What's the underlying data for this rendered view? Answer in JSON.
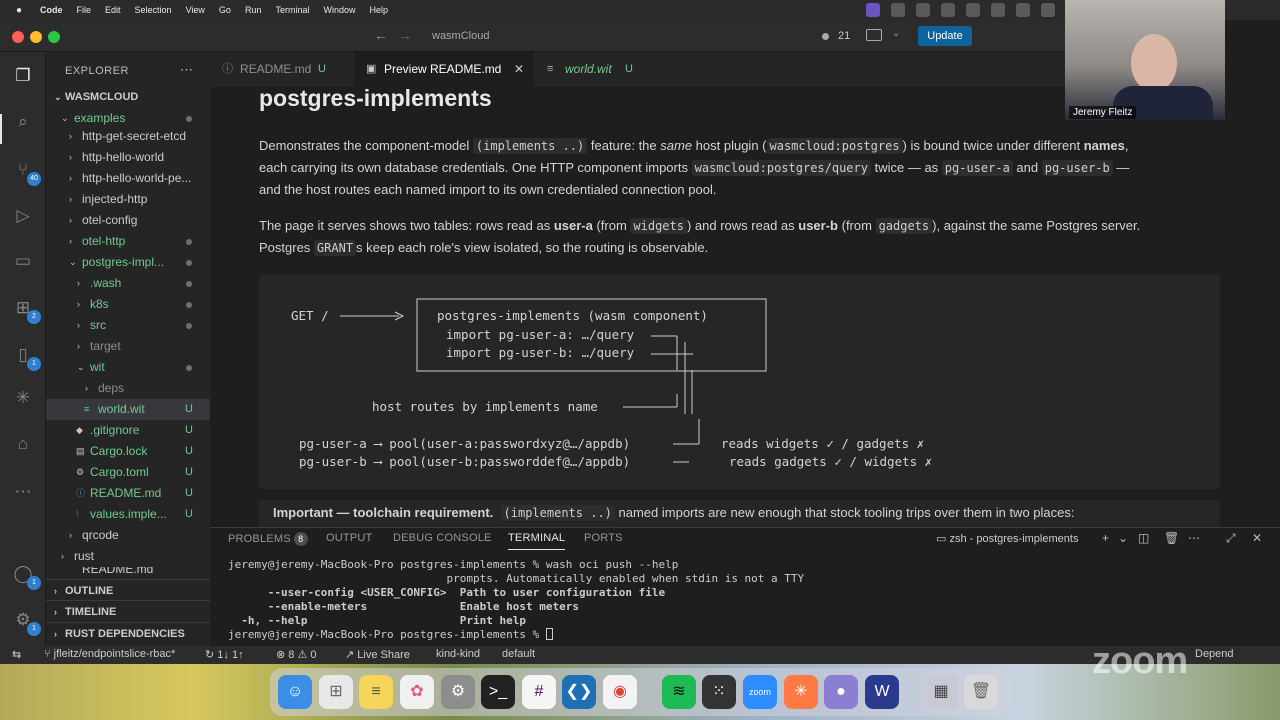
{
  "menubar": {
    "app": "Code",
    "items": [
      "File",
      "Edit",
      "Selection",
      "View",
      "Go",
      "Run",
      "Terminal",
      "Window",
      "Help"
    ]
  },
  "titlebar": {
    "command_center": "wasmCloud",
    "ports_count": "21",
    "update_label": "Update"
  },
  "activity": {
    "scm_badge": "40",
    "extensions_badge": "2",
    "remote_badge": "1",
    "accounts_badge": "1",
    "settings_badge": "1"
  },
  "sidebar": {
    "title": "EXPLORER",
    "root": "WASMCLOUD",
    "items": [
      {
        "label": "examples",
        "status": ""
      },
      {
        "label": "http-get-secret-etcd",
        "status": ""
      },
      {
        "label": "http-hello-world",
        "status": ""
      },
      {
        "label": "http-hello-world-pe...",
        "status": ""
      },
      {
        "label": "injected-http",
        "status": ""
      },
      {
        "label": "otel-config",
        "status": ""
      },
      {
        "label": "otel-http",
        "status": ""
      },
      {
        "label": "postgres-impl...",
        "status": ""
      },
      {
        "label": ".wash",
        "status": ""
      },
      {
        "label": "k8s",
        "status": ""
      },
      {
        "label": "src",
        "status": ""
      },
      {
        "label": "target",
        "status": ""
      },
      {
        "label": "wit",
        "status": ""
      },
      {
        "label": "deps",
        "status": ""
      },
      {
        "label": "world.wit",
        "status": "U"
      },
      {
        "label": ".gitignore",
        "status": "U"
      },
      {
        "label": "Cargo.lock",
        "status": "U"
      },
      {
        "label": "Cargo.toml",
        "status": "U"
      },
      {
        "label": "README.md",
        "status": "U"
      },
      {
        "label": "values.imple...",
        "status": "U"
      },
      {
        "label": "qrcode",
        "status": ""
      },
      {
        "label": "rust",
        "status": ""
      },
      {
        "label": "README.md",
        "status": ""
      }
    ],
    "sections": [
      "OUTLINE",
      "TIMELINE",
      "RUST DEPENDENCIES"
    ]
  },
  "tabs": [
    {
      "label": "README.md",
      "status": "U"
    },
    {
      "label": "Preview README.md",
      "status": ""
    },
    {
      "label": "world.wit",
      "status": "U"
    }
  ],
  "preview": {
    "title": "postgres-implements",
    "p1": {
      "t1": "Demonstrates the component-model ",
      "c1": "(implements ..)",
      "t2": " feature: the ",
      "em": "same",
      "t3": " host plugin (",
      "c2": "wasmcloud:postgres",
      "t4": ") is bound twice under different ",
      "b1": "names",
      "t5": ",",
      "t6": "each carrying its own database credentials. One HTTP component imports ",
      "c3": "wasmcloud:postgres/query",
      "t7": " twice — as ",
      "c4": "pg-user-a",
      "t8": " and ",
      "c5": "pg-user-b",
      "t9": " —",
      "t10": "and the host routes each named import to its own credentialed connection pool."
    },
    "p2": {
      "t1": "The page it serves shows two tables: rows read as ",
      "b1": "user-a",
      "t2": " (from ",
      "c1": "widgets",
      "t3": ") and rows read as ",
      "b2": "user-b",
      "t4": " (from ",
      "c2": "gadgets",
      "t5": "), against the same Postgres server.",
      "t6": "Postgres ",
      "c3": "GRANT",
      "t7": "s keep each role's view isolated, so the routing is observable."
    },
    "diagram": {
      "get": "GET /",
      "box_title": "postgres-implements (wasm component)",
      "import_a": "import pg-user-a: …/query",
      "import_b": "import pg-user-b: …/query",
      "routes": "host routes by implements name",
      "pool_a": "pg-user-a ⟶ pool(user-a:passwordxyz@…/appdb)",
      "pool_b": "pg-user-b ⟶ pool(user-b:passworddef@…/appdb)",
      "reads_a": "reads widgets ✓ / gadgets ✗",
      "reads_b": "reads gadgets ✓ / widgets ✗"
    },
    "important": {
      "b1": "Important — toolchain requirement.",
      "c1": "(implements ..)",
      "t1": " named imports are new enough that stock tooling trips over them in two places:"
    }
  },
  "panel": {
    "tabs": [
      "PROBLEMS",
      "OUTPUT",
      "DEBUG CONSOLE",
      "TERMINAL",
      "PORTS"
    ],
    "problems_count": "8",
    "terminal_name": "zsh - postgres-implements",
    "lines": [
      "jeremy@jeremy-MacBook-Pro postgres-implements % wash oci push --help",
      "                                 prompts. Automatically enabled when stdin is not a TTY",
      "      --user-config <USER_CONFIG>  Path to user configuration file",
      "      --enable-meters              Enable host meters",
      "  -h, --help                       Print help",
      "jeremy@jeremy-MacBook-Pro postgres-implements % "
    ]
  },
  "statusbar": {
    "branch": "jfleitz/endpointslice-rbac*",
    "sync": "1↓ 1↑",
    "errors": "8",
    "warnings": "0",
    "live_share": "Live Share",
    "context": "kind-kind",
    "namespace": "default",
    "right": "Depend"
  },
  "video": {
    "name": "Jeremy Fleitz",
    "watermark": "zoom"
  },
  "colors": {
    "accent": "#0e639c",
    "untracked": "#73c991"
  }
}
